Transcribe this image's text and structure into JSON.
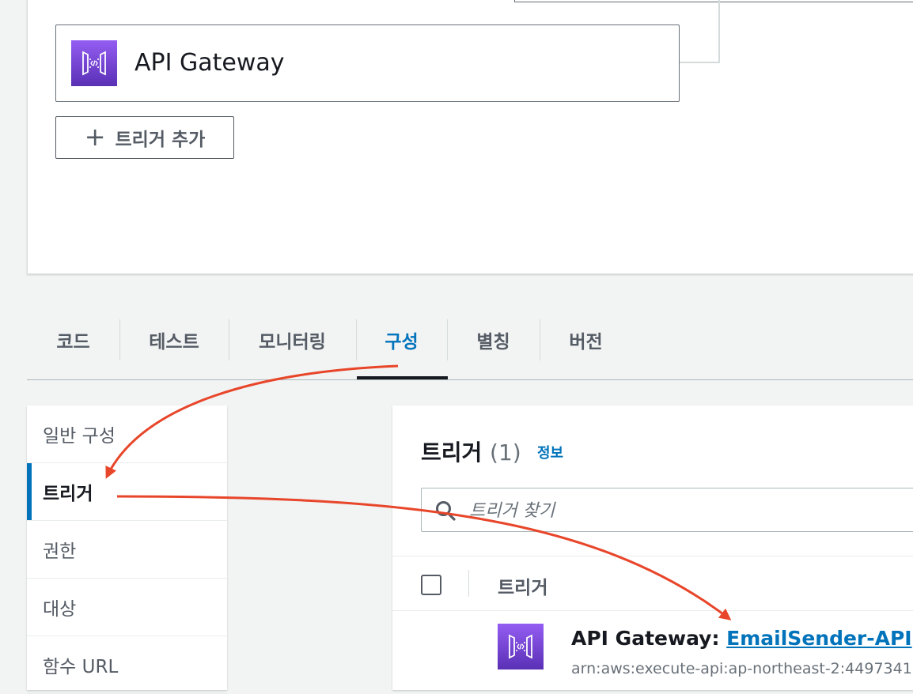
{
  "designer": {
    "trigger_card_label": "API Gateway",
    "add_trigger_label": "트리거 추가"
  },
  "tabs": [
    {
      "label": "코드"
    },
    {
      "label": "테스트"
    },
    {
      "label": "모니터링"
    },
    {
      "label": "구성",
      "active": true
    },
    {
      "label": "별칭"
    },
    {
      "label": "버전"
    }
  ],
  "side_nav": {
    "items": [
      {
        "label": "일반 구성"
      },
      {
        "label": "트리거",
        "active": true
      },
      {
        "label": "권한"
      },
      {
        "label": "대상"
      },
      {
        "label": "함수 URL"
      }
    ]
  },
  "triggers_panel": {
    "title": "트리거",
    "count": "(1)",
    "info_label": "정보",
    "search_placeholder": "트리거 찾기",
    "column_header": "트리거",
    "rows": [
      {
        "service": "API Gateway",
        "separator": ": ",
        "name": "EmailSender-API",
        "arn": "arn:aws:execute-api:ap-northeast-2:4497341"
      }
    ]
  },
  "colors": {
    "accent": "#0073bb",
    "annotation_arrow": "#e8462a",
    "apigw_icon_top": "#945df2",
    "apigw_icon_bottom": "#5a30b5"
  },
  "icons": [
    "api-gateway-icon",
    "plus-icon",
    "search-icon"
  ]
}
